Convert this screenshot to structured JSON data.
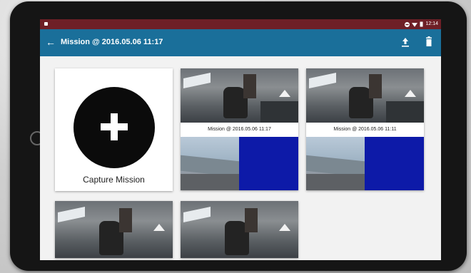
{
  "status_bar": {
    "time": "12:14"
  },
  "app_bar": {
    "title": "Mission @ 2016.05.06 11:17"
  },
  "capture": {
    "label": "Capture Mission"
  },
  "missions": [
    {
      "label": "Mission @ 2016.05.06 11:17"
    },
    {
      "label": "Mission @ 2016.05.06 11:11"
    }
  ],
  "colors": {
    "status_bar": "#6e1f26",
    "app_bar": "#1a6f9a",
    "overlay_blue": "#0d1aa8"
  },
  "icons": {
    "back": "arrow-left-icon",
    "upload": "upload-icon",
    "delete": "trash-icon",
    "capture": "plus-icon"
  }
}
